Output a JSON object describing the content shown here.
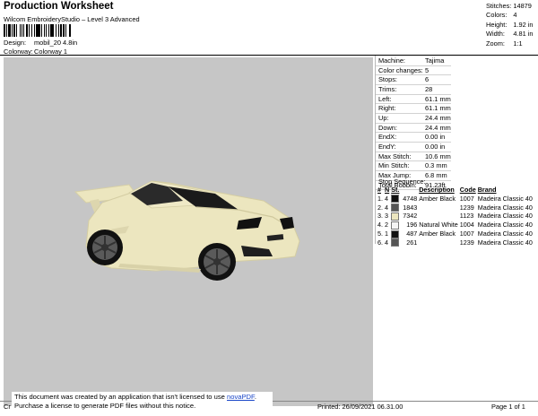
{
  "header": {
    "title": "Production Worksheet",
    "subtitle": "Wilcom EmbroideryStudio – Level 3 Advanced",
    "design_label": "Design:",
    "design_value": "mobil_20 4.8in",
    "colorway_label": "Colorway:",
    "colorway_value": "Colorway 1"
  },
  "stats": [
    {
      "label": "Stitches:",
      "value": "14879"
    },
    {
      "label": "Colors:",
      "value": "4"
    },
    {
      "label": "Height:",
      "value": "1.92 in"
    },
    {
      "label": "Width:",
      "value": "4.81 in"
    },
    {
      "label": "Zoom:",
      "value": "1:1"
    }
  ],
  "specs": [
    {
      "label": "Machine:",
      "value": "Tajima"
    },
    {
      "label": "Color changes:",
      "value": "5"
    },
    {
      "label": "Stops:",
      "value": "6"
    },
    {
      "label": "Trims:",
      "value": "28"
    },
    {
      "label": "Left:",
      "value": "61.1 mm"
    },
    {
      "label": "Right:",
      "value": "61.1 mm"
    },
    {
      "label": "Up:",
      "value": "24.4 mm"
    },
    {
      "label": "Down:",
      "value": "24.4 mm"
    },
    {
      "label": "EndX:",
      "value": "0.00 in"
    },
    {
      "label": "EndY:",
      "value": "0.00 in"
    },
    {
      "label": "Max Stitch:",
      "value": "10.6 mm"
    },
    {
      "label": "Min Stitch:",
      "value": "0.3 mm"
    },
    {
      "label": "Max Jump:",
      "value": "6.8 mm"
    },
    {
      "label": "Total Bobbin:",
      "value": "91.23ft"
    }
  ],
  "stop_sequence": {
    "title": "Stop Sequence:",
    "headers": [
      "#",
      "N",
      "St.",
      "Description",
      "Code",
      "Brand"
    ],
    "rows": [
      {
        "num": "1.",
        "needle": "4",
        "color": "#111111",
        "stitches": "4748",
        "description": "Amber Black",
        "code": "1007",
        "brand": "Madeira Classic 40"
      },
      {
        "num": "2.",
        "needle": "4",
        "color": "#555555",
        "stitches": "1843",
        "description": "",
        "code": "1239",
        "brand": "Madeira Classic 40"
      },
      {
        "num": "3.",
        "needle": "3",
        "color": "#ece6bf",
        "stitches": "7342",
        "description": "",
        "code": "1123",
        "brand": "Madeira Classic 40"
      },
      {
        "num": "4.",
        "needle": "2",
        "color": "#f4f4f4",
        "stitches": "196",
        "description": "Natural White",
        "code": "1004",
        "brand": "Madeira Classic 40"
      },
      {
        "num": "5.",
        "needle": "1",
        "color": "#111111",
        "stitches": "487",
        "description": "Amber Black",
        "code": "1007",
        "brand": "Madeira Classic 40"
      },
      {
        "num": "6.",
        "needle": "4",
        "color": "#555555",
        "stitches": "261",
        "description": "",
        "code": "1239",
        "brand": "Madeira Classic 40"
      }
    ]
  },
  "footer": {
    "notice_line1": "This document was created by an application that isn't licensed to use",
    "notice_link": "novaPDF",
    "notice_line2": "Purchase a license to generate PDF files without this notice.",
    "cr": "Cr",
    "printed": "Printed: 26/09/2021 06.31.00",
    "page": "Page 1 of 1"
  },
  "colors": {
    "canvas_bg": "#c6c6c6",
    "car_body": "#ece6bf",
    "tire": "#111111",
    "rim": "#555555",
    "link": "#1a46c8"
  }
}
